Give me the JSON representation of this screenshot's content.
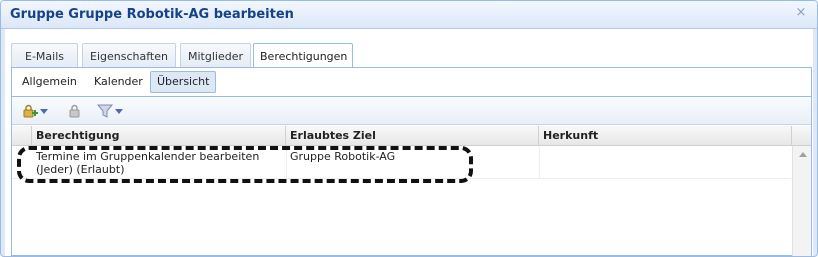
{
  "window": {
    "title": "Gruppe Gruppe Robotik-AG bearbeiten",
    "close_glyph": "×"
  },
  "tabs": [
    {
      "label": "E-Mails"
    },
    {
      "label": "Eigenschaften"
    },
    {
      "label": "Mitglieder"
    },
    {
      "label": "Berechtigungen"
    }
  ],
  "subtabs": [
    {
      "label": "Allgemein"
    },
    {
      "label": "Kalender"
    },
    {
      "label": "Übersicht"
    }
  ],
  "toolbar": {
    "icons": [
      "add-permission-icon",
      "remove-permission-icon",
      "filter-icon"
    ],
    "accent": "#4a6fa5"
  },
  "grid": {
    "columns": [
      "Berechtigung",
      "Erlaubtes Ziel",
      "Herkunft"
    ],
    "rows": [
      {
        "berechtigung_line1": "Termine im Gruppenkalender bearbeiten",
        "berechtigung_line2": "(Jeder) (Erlaubt)",
        "ziel": "Gruppe Robotik-AG",
        "herkunft": ""
      }
    ]
  },
  "colors": {
    "border": "#99bbe8",
    "title": "#15428b",
    "active_subtab_bg": "#dde8f5"
  }
}
